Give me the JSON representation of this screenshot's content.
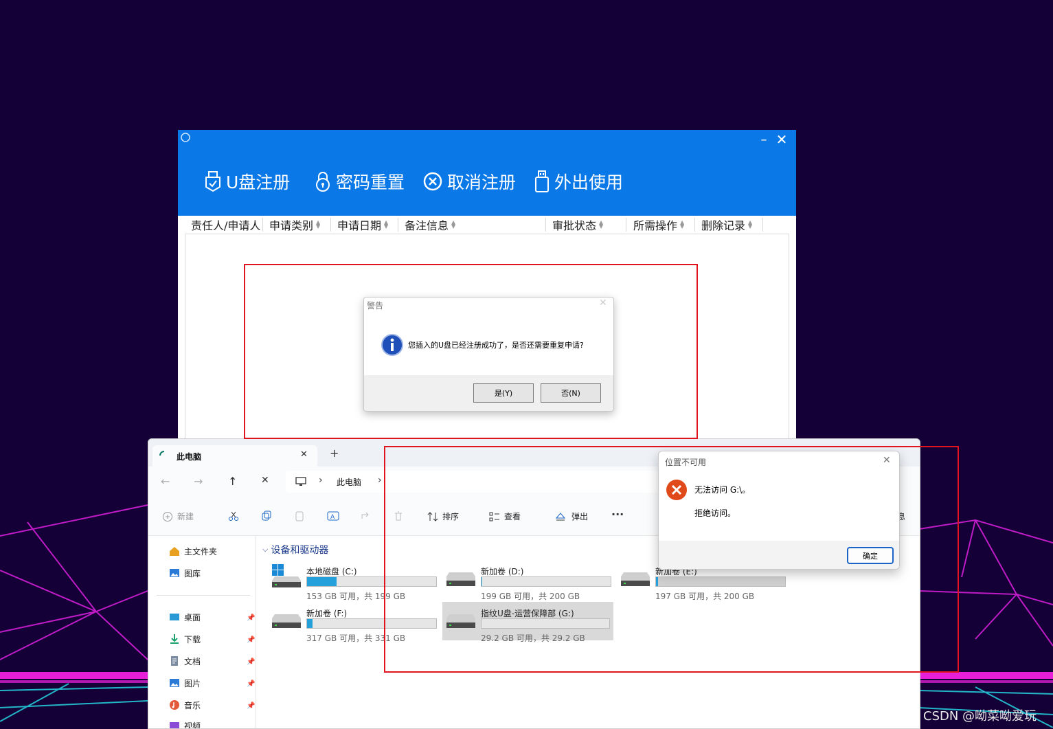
{
  "app": {
    "toolbar": [
      {
        "label": "U盘注册",
        "icon": "usb-shield-icon"
      },
      {
        "label": "密码重置",
        "icon": "lock-icon"
      },
      {
        "label": "取消注册",
        "icon": "cancel-circle-icon"
      },
      {
        "label": "外出使用",
        "icon": "usb-drive-icon"
      }
    ],
    "window_controls": {
      "minimize": "–",
      "close": "✕"
    },
    "columns": [
      "责任人/申请人",
      "申请类别",
      "申请日期",
      "备注信息",
      "审批状态",
      "所需操作",
      "删除记录"
    ],
    "accent": "#0a78e6"
  },
  "warning_dialog": {
    "title": "警告",
    "close": "✕",
    "message": "您插入的U盘已经注册成功了，是否还需要重复申请?",
    "yes": "是(Y)",
    "no": "否(N)"
  },
  "explorer": {
    "tab_title": "此电脑",
    "tab_close": "✕",
    "new_tab": "+",
    "nav": {
      "back": "←",
      "forward": "→",
      "up": "↑",
      "stop": "✕",
      "breadcrumb_root": "此电脑",
      "sep": "›",
      "sep2": "›"
    },
    "toolbar": {
      "new": "新建",
      "sort": "排序",
      "view": "查看",
      "eject": "弹出",
      "more": "···",
      "right_cut": "息"
    },
    "sidebar": {
      "home": "主文件夹",
      "gallery": "图库",
      "pinned": [
        "桌面",
        "下载",
        "文档",
        "图片",
        "音乐",
        "视频"
      ]
    },
    "section_title": "设备和驱动器",
    "drives": [
      {
        "name": "本地磁盘 (C:)",
        "free": "153 GB 可用，共 199 GB",
        "used_fraction": 0.23
      },
      {
        "name": "新加卷 (D:)",
        "free": "199 GB 可用，共 200 GB",
        "used_fraction": 0.005
      },
      {
        "name": "新加卷 (E:)",
        "free": "197 GB 可用，共 200 GB",
        "used_fraction": 0.015
      },
      {
        "name": "新加卷 (F:)",
        "free": "317 GB 可用，共 331 GB",
        "used_fraction": 0.04
      },
      {
        "name": "指纹U盘-运营保障部 (G:)",
        "free": "29.2 GB 可用，共 29.2 GB",
        "used_fraction": 0.0
      }
    ]
  },
  "location_dialog": {
    "title": "位置不可用",
    "close": "✕",
    "line1": "无法访问 G:\\。",
    "line2": "拒绝访问。",
    "ok": "确定"
  },
  "watermark": "CSDN @呦菜呦爱玩"
}
